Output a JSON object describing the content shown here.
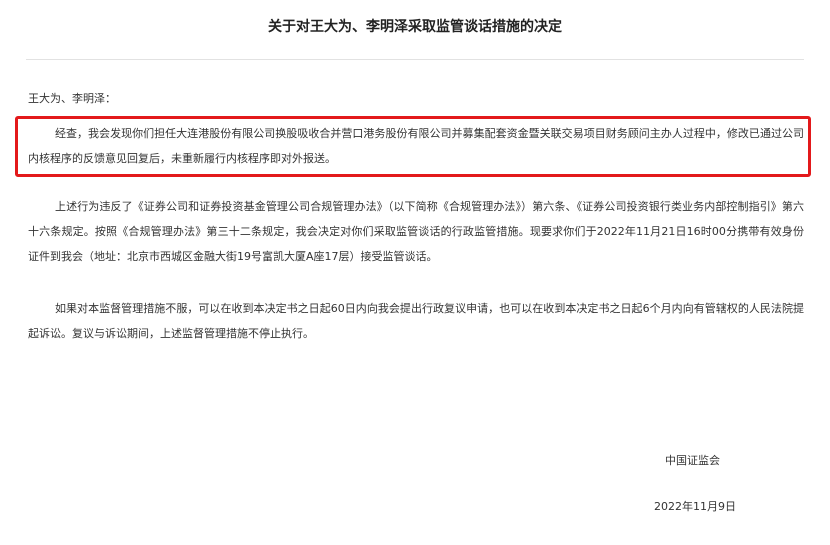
{
  "document": {
    "title": "关于对王大为、李明泽采取监管谈话措施的决定",
    "salutation": "王大为、李明泽：",
    "paragraphs": [
      "经查，我会发现你们担任大连港股份有限公司换股吸收合并营口港务股份有限公司并募集配套资金暨关联交易项目财务顾问主办人过程中，修改已通过公司内核程序的反馈意见回复后，未重新履行内核程序即对外报送。",
      "上述行为违反了《证券公司和证券投资基金管理公司合规管理办法》（以下简称《合规管理办法》）第六条、《证券公司投资银行类业务内部控制指引》第六十六条规定。按照《合规管理办法》第三十二条规定，我会决定对你们采取监管谈话的行政监管措施。现要求你们于2022年11月21日16时00分携带有效身份证件到我会（地址：北京市西城区金融大街19号富凯大厦A座17层）接受监管谈话。",
      "如果对本监督管理措施不服，可以在收到本决定书之日起60日内向我会提出行政复议申请，也可以在收到本决定书之日起6个月内向有管辖权的人民法院提起诉讼。复议与诉讼期间，上述监督管理措施不停止执行。"
    ],
    "issuer": "中国证监会",
    "date": "2022年11月9日"
  },
  "colors": {
    "highlight_border": "#e3191b",
    "text": "#333333",
    "divider": "#e2e2e2"
  }
}
